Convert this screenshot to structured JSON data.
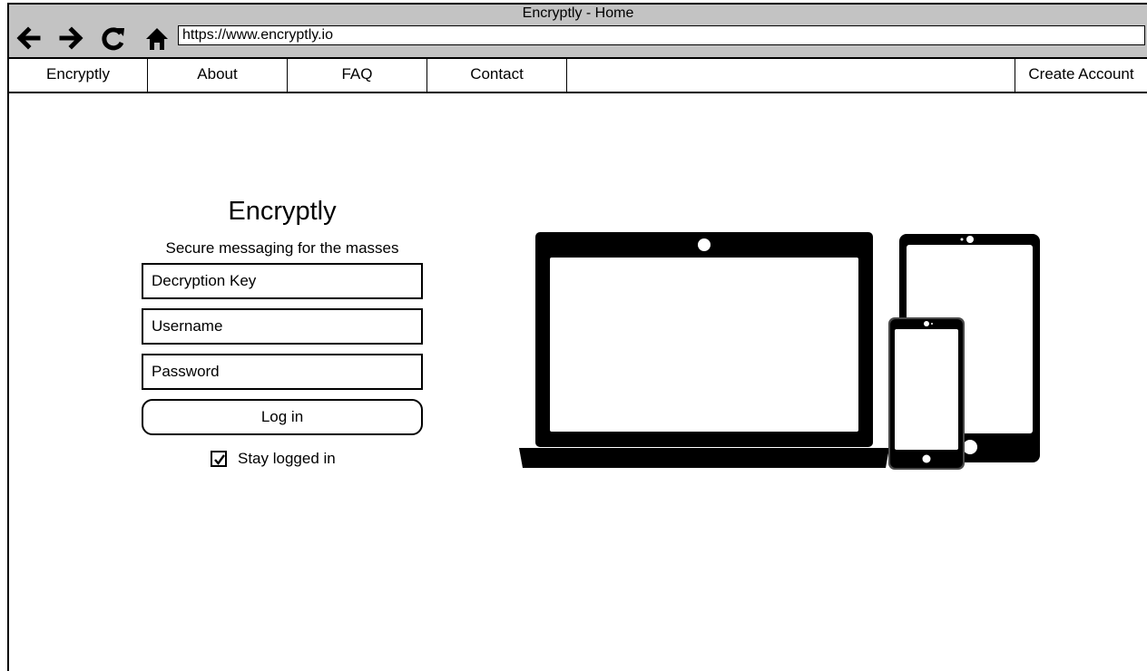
{
  "window": {
    "title": "Encryptly - Home"
  },
  "browser": {
    "url": "https://www.encryptly.io",
    "buttons": [
      "back-arrow-icon",
      "forward-arrow-icon",
      "reload-icon",
      "home-icon"
    ]
  },
  "nav": {
    "items": [
      "Encryptly",
      "About",
      "FAQ",
      "Contact"
    ],
    "create_account": "Create Account"
  },
  "login": {
    "brand": "Encryptly",
    "tagline": "Secure messaging for the masses",
    "fields": {
      "decryption_key": "Decryption Key",
      "username": "Username",
      "password": "Password"
    },
    "login_label": "Log in",
    "stay_logged_in": {
      "label": "Stay logged in",
      "checked": true
    }
  },
  "illustration": {
    "icon": "devices-icon"
  }
}
